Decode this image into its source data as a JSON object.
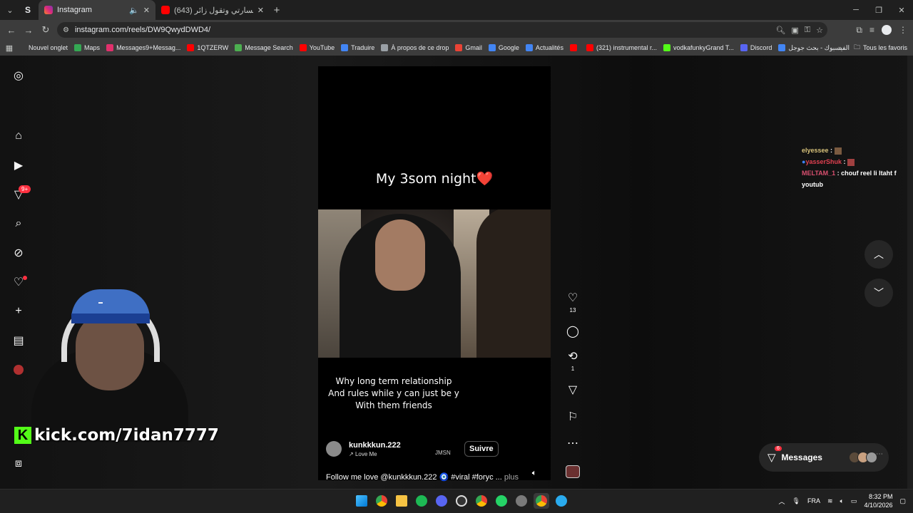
{
  "browser": {
    "tabs": [
      {
        "title": "Instagram",
        "active": true,
        "icon": "instagram-icon"
      },
      {
        "title": "(643) تتبع في خسارتي وتقول زائر",
        "active": false,
        "icon": "youtube-icon"
      }
    ],
    "url": "instagram.com/reels/DW9QwydDWD4/",
    "bookmarks": [
      {
        "label": "Nouvel onglet",
        "color": "#3c3c3c"
      },
      {
        "label": "Maps",
        "color": "#34a853"
      },
      {
        "label": "Messages9+Messag...",
        "color": "#e1306c"
      },
      {
        "label": "1QTZERW",
        "color": "#ff0000"
      },
      {
        "label": "Message Search",
        "color": "#4caf50"
      },
      {
        "label": "YouTube",
        "color": "#ff0000"
      },
      {
        "label": "Traduire",
        "color": "#4285f4"
      },
      {
        "label": "À propos de ce drop",
        "color": "#9aa0a6"
      },
      {
        "label": "Gmail",
        "color": "#ea4335"
      },
      {
        "label": "Google",
        "color": "#4285f4"
      },
      {
        "label": "Actualités",
        "color": "#4285f4"
      },
      {
        "label": "",
        "color": "#ff0000"
      },
      {
        "label": "(321) instrumental r...",
        "color": "#ff0000"
      },
      {
        "label": "vodkafunkyGrand T...",
        "color": "#53fc18"
      },
      {
        "label": "Discord",
        "color": "#5865f2"
      },
      {
        "label": "الفيسبوك - بحث جوجل",
        "color": "#4285f4"
      }
    ],
    "all_bookmarks": "Tous les favoris"
  },
  "sidebar": {
    "notifications_badge": "9+"
  },
  "reel": {
    "caption_top": "My 3som night❤️",
    "caption_bottom": [
      "Why long term relationship",
      "And rules while y can just be y",
      "With them friends"
    ],
    "username": "kunkkkun.222",
    "song": "Love Me",
    "overlay_tag": "JMSN",
    "follow_label": "Suivre",
    "description": "Follow me love @kunkkkun.222 🧿 #viral #foryc ...",
    "more_label": "plus",
    "likes": "13",
    "reposts": "1"
  },
  "chat": [
    {
      "user": "elyessee",
      "msg": "",
      "color": "#d7c27a"
    },
    {
      "user": "yasserShuk",
      "msg": "",
      "color": "#e04050"
    },
    {
      "user": "MELTAM_1",
      "msg": "chouf reel li ltaht f youtub",
      "color": "#d94f6f"
    }
  ],
  "overlay": {
    "kick_url": "kick.com/7idan7777"
  },
  "messages": {
    "label": "Messages",
    "count": "6"
  },
  "taskbar": {
    "lang": "FRA",
    "time": "8:32 PM",
    "date": "4/10/2026"
  }
}
